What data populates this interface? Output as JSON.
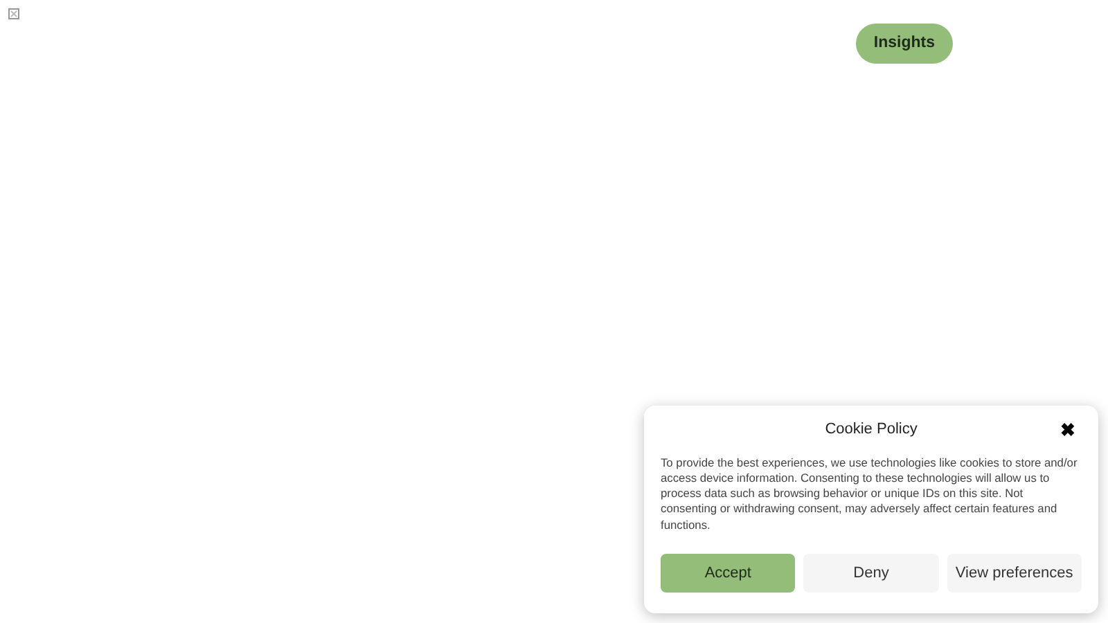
{
  "header": {
    "button": "Insights"
  },
  "cookie_banner": {
    "title": "Cookie Policy",
    "close": "✖",
    "message": "To provide the best experiences, we use technologies like cookies to store and/or access device information. Consenting to these technologies will allow us to process data such as browsing behavior or unique IDs on this site. Not consenting or withdrawing consent, may adversely affect certain features and functions.",
    "buttons": [
      {
        "label": "Accept",
        "kind": "primary"
      },
      {
        "label": "Deny",
        "kind": "secondary"
      },
      {
        "label": "View preferences",
        "kind": "secondary"
      }
    ]
  }
}
